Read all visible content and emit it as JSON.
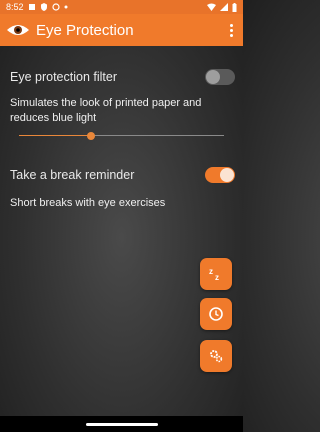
{
  "status_bar": {
    "time": "8:52",
    "left_icons": [
      "notification-icon",
      "shield-icon",
      "sync-icon",
      "dot-icon"
    ],
    "right_icons": [
      "wifi-icon",
      "signal-icon",
      "battery-icon"
    ]
  },
  "app_bar": {
    "title": "Eye Protection",
    "logo_icon": "eye-logo-icon",
    "menu_icon": "overflow-menu-icon"
  },
  "settings": {
    "filter": {
      "title": "Eye protection filter",
      "enabled": false,
      "description": "Simulates the look of printed paper and reduces blue light",
      "slider_level_percent": 35
    },
    "break_reminder": {
      "title": "Take a break reminder",
      "enabled": true,
      "description": "Short breaks with eye exercises"
    }
  },
  "fabs": [
    {
      "icon": "sleep-icon"
    },
    {
      "icon": "clock-icon"
    },
    {
      "icon": "settings-gears-icon"
    }
  ],
  "colors": {
    "accent": "#f07a2b",
    "status_bar": "#e8732a",
    "background": "#3a3a3a"
  }
}
